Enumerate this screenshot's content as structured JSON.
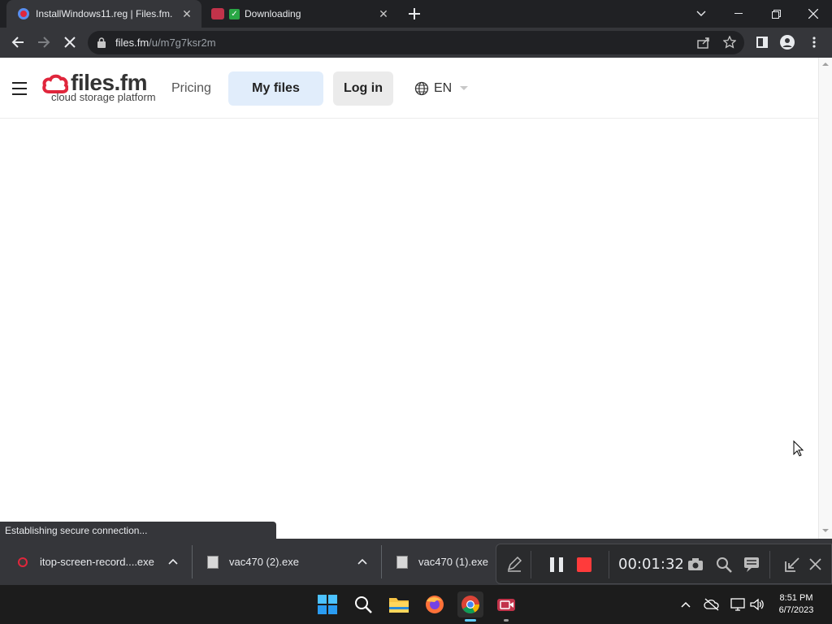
{
  "browser": {
    "tabs": [
      {
        "title": "InstallWindows11.reg | Files.fm."
      },
      {
        "title": "Downloading"
      }
    ],
    "url_host": "files.fm",
    "url_path": "/u/m7g7ksr2m",
    "status_text": "Establishing secure connection..."
  },
  "site": {
    "logo_name": "files.fm",
    "logo_tagline": "cloud storage platform",
    "nav": {
      "pricing": "Pricing",
      "my_files": "My files",
      "login": "Log in",
      "language": "EN"
    },
    "colors": {
      "brand_red": "#e0263c",
      "pill_blue": "#e1edfb",
      "pill_gray": "#ebebeb"
    }
  },
  "downloads": [
    {
      "name": "itop-screen-record....exe"
    },
    {
      "name": "vac470 (2).exe"
    },
    {
      "name": "vac470 (1).exe"
    }
  ],
  "recorder": {
    "elapsed": "00:01:32"
  },
  "taskbar": {
    "time": "8:51 PM",
    "date": "6/7/2023"
  }
}
